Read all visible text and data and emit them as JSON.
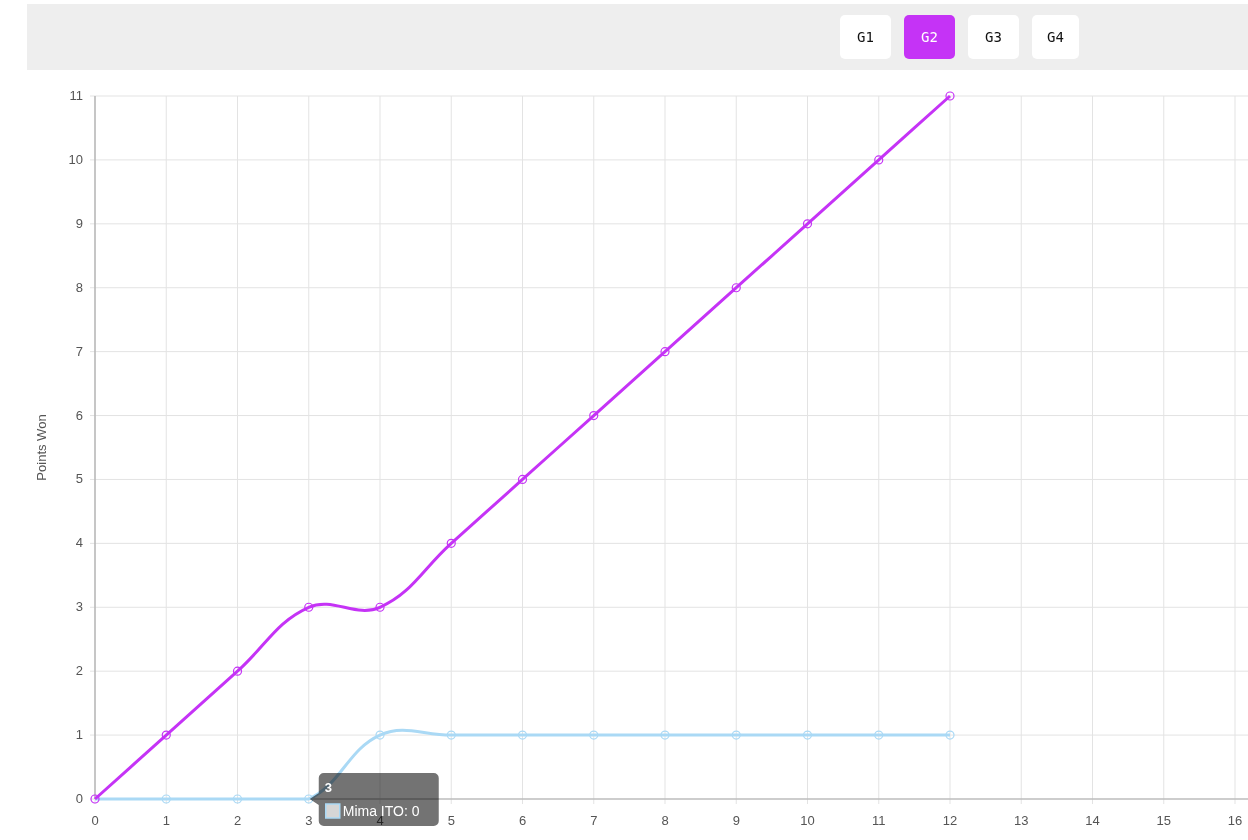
{
  "game_tabs": [
    {
      "label": "G1",
      "selected": false
    },
    {
      "label": "G2",
      "selected": true
    },
    {
      "label": "G3",
      "selected": false
    },
    {
      "label": "G4",
      "selected": false
    }
  ],
  "chart": {
    "chart_data": {
      "type": "line",
      "ylabel": "Points Won",
      "x": [
        0,
        1,
        2,
        3,
        4,
        5,
        6,
        7,
        8,
        9,
        10,
        11,
        12
      ],
      "series": [
        {
          "color": "#c533f6",
          "marker": "circle",
          "values": [
            0,
            1,
            2,
            3,
            3,
            4,
            5,
            6,
            7,
            8,
            9,
            10,
            11
          ]
        },
        {
          "color": "#aad9f5",
          "marker": "circle",
          "values": [
            0,
            0,
            0,
            0,
            1,
            1,
            1,
            1,
            1,
            1,
            1,
            1,
            1
          ]
        }
      ],
      "xlim": [
        0,
        16
      ],
      "ylim": [
        0,
        11
      ],
      "grid": true,
      "xticks": [
        0,
        1,
        2,
        3,
        4,
        5,
        6,
        7,
        8,
        9,
        10,
        11,
        12,
        13,
        14,
        15,
        16
      ],
      "yticks": [
        0,
        1,
        2,
        3,
        4,
        5,
        6,
        7,
        8,
        9,
        10,
        11
      ]
    },
    "tooltip": {
      "title": "3",
      "label": "Mima ITO: 0"
    }
  }
}
